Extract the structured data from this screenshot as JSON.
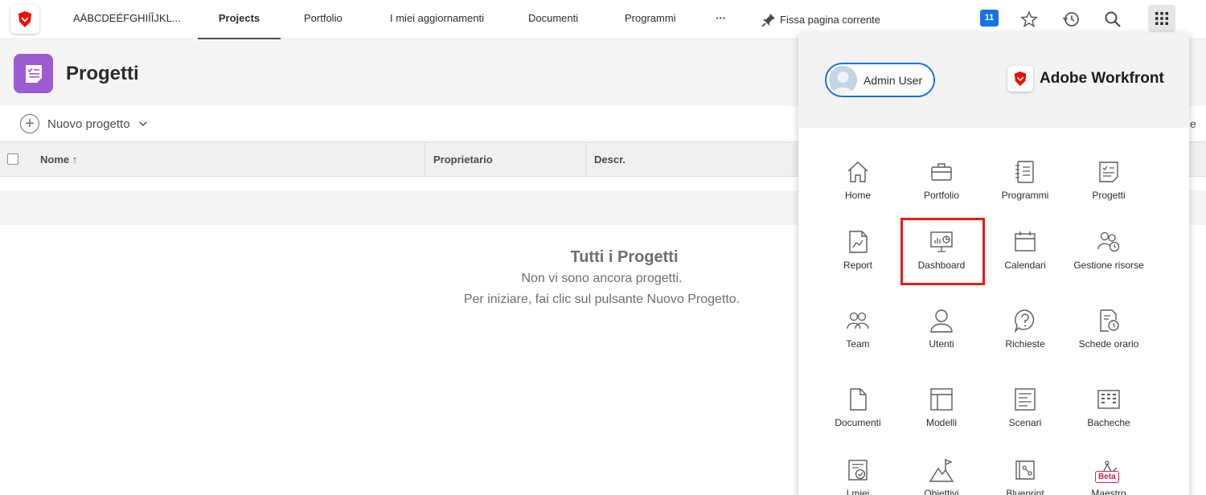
{
  "topnav": {
    "tab_truncated": "AÁBCDEÉFGHIÍÎJKL...",
    "items": [
      {
        "label": "Projects",
        "active": true
      },
      {
        "label": "Portfolio"
      },
      {
        "label": "I miei aggiornamenti"
      },
      {
        "label": "Documenti"
      },
      {
        "label": "Programmi"
      }
    ],
    "more_label": "···",
    "pin_label": "Fissa pagina corrente",
    "notification_count": "11",
    "icons": [
      "star-icon",
      "history-icon",
      "search-icon",
      "app-grid-icon"
    ]
  },
  "page": {
    "title": "Progetti",
    "new_button": "Nuovo progetto",
    "right_cut_text": "e",
    "columns": [
      "Nome ↑",
      "Proprietario",
      "Descr."
    ],
    "empty": {
      "title": "Tutti i Progetti",
      "line1": "Non vi sono ancora progetti.",
      "line2": "Per iniziare, fai clic sul pulsante Nuovo Progetto."
    }
  },
  "launcher": {
    "user_name": "Admin User",
    "brand": "Adobe Workfront",
    "apps": [
      {
        "label": "Home",
        "icon": "home-icon"
      },
      {
        "label": "Portfolio",
        "icon": "briefcase-icon"
      },
      {
        "label": "Programmi",
        "icon": "notebook-icon"
      },
      {
        "label": "Progetti",
        "icon": "checklist-icon"
      },
      {
        "label": "Report",
        "icon": "report-icon"
      },
      {
        "label": "Dashboard",
        "icon": "dashboard-icon",
        "highlighted": true
      },
      {
        "label": "Calendari",
        "icon": "calendar-icon"
      },
      {
        "label": "Gestione risorse",
        "icon": "resource-icon"
      },
      {
        "label": "Team",
        "icon": "team-icon"
      },
      {
        "label": "Utenti",
        "icon": "user-icon"
      },
      {
        "label": "Richieste",
        "icon": "question-icon"
      },
      {
        "label": "Schede orario",
        "icon": "timesheet-icon"
      },
      {
        "label": "Documenti",
        "icon": "document-icon"
      },
      {
        "label": "Modelli",
        "icon": "template-icon"
      },
      {
        "label": "Scenari",
        "icon": "scenario-icon"
      },
      {
        "label": "Bacheche",
        "icon": "board-icon"
      },
      {
        "label": "I miei",
        "icon": "my-work-icon"
      },
      {
        "label": "Obiettivi",
        "icon": "goals-icon"
      },
      {
        "label": "Blueprint",
        "icon": "blueprint-icon"
      },
      {
        "label": "Maestro",
        "icon": "maestro-icon",
        "tag": "Beta"
      }
    ]
  },
  "colors": {
    "accent_blue": "#1473e6",
    "project_purple": "#9d5bd2",
    "highlight_red": "#e31d1d",
    "brand_red": "#eb1000"
  }
}
